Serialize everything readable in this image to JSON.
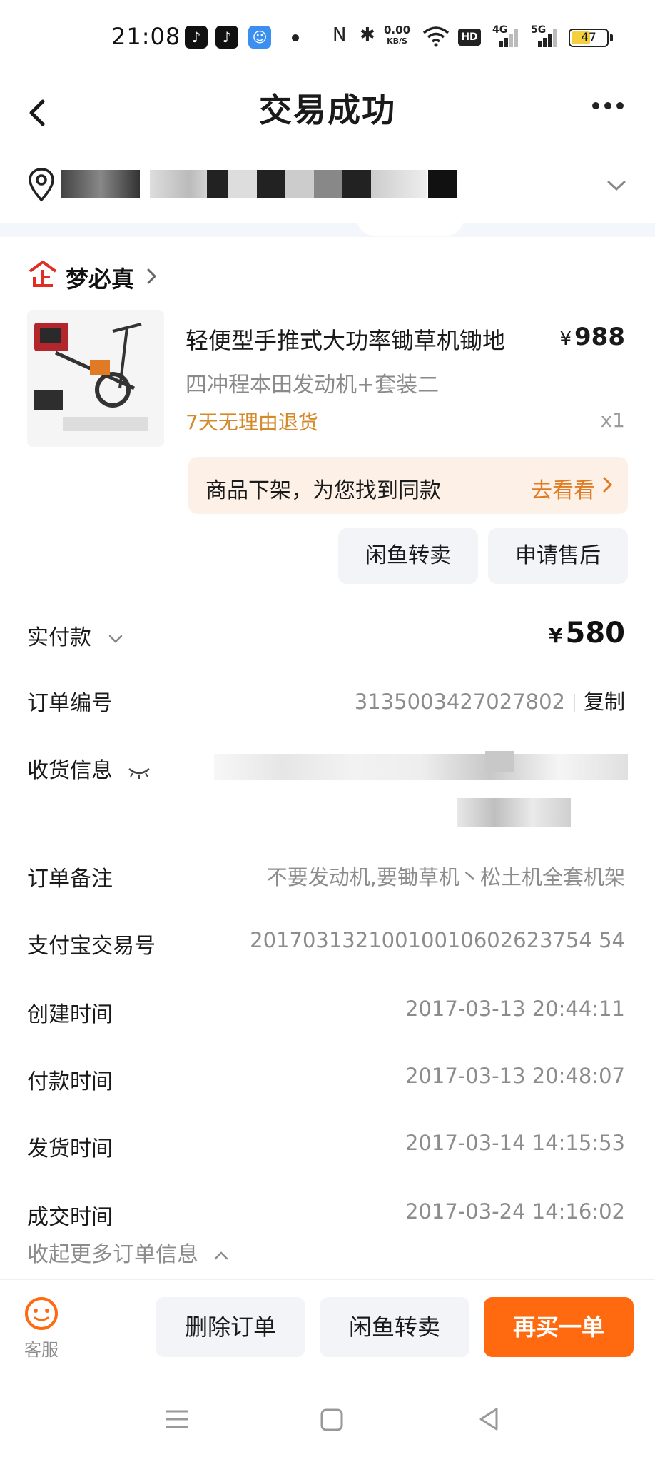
{
  "status_bar": {
    "time": "21:08",
    "net_speed_value": "0.00",
    "net_speed_unit": "KB/S",
    "hd_label": "HD",
    "net_4g": "4G",
    "net_5g": "5G",
    "battery": "47"
  },
  "nav": {
    "title": "交易成功"
  },
  "shop": {
    "badge_icon": "enterprise-badge-icon",
    "name": "梦必真"
  },
  "product": {
    "title": "轻便型手推式大功率锄草机锄地",
    "price_symbol": "¥",
    "price": "988",
    "spec": "四冲程本田发动机+套装二",
    "return_policy": "7天无理由退货",
    "quantity": "x1"
  },
  "off_shelf": {
    "text": "商品下架，为您找到同款",
    "link": "去看看"
  },
  "actions": {
    "resell": "闲鱼转卖",
    "after_sale": "申请售后"
  },
  "order": {
    "paid_label": "实付款",
    "paid_symbol": "¥",
    "paid_amount": "580",
    "number_label": "订单编号",
    "number_value": "3135003427027802",
    "copy_label": "复制",
    "shipping_label": "收货信息",
    "remark_label": "订单备注",
    "remark_value": "不要发动机,要锄草机丶松土机全套机架",
    "alipay_label": "支付宝交易号",
    "alipay_value": "20170313210010010602623754 54",
    "created_label": "创建时间",
    "created_value": "2017-03-13 20:44:11",
    "paid_time_label": "付款时间",
    "paid_time_value": "2017-03-13 20:48:07",
    "shipped_label": "发货时间",
    "shipped_value": "2017-03-14 14:15:53",
    "completed_label": "成交时间",
    "completed_value": "2017-03-24 14:16:02",
    "collapse_label": "收起更多订单信息"
  },
  "bottom_bar": {
    "service_label": "客服",
    "delete": "删除订单",
    "resell": "闲鱼转卖",
    "rebuy": "再买一单"
  },
  "colors": {
    "accent_orange": "#ff6a10",
    "return_orange": "#d4892b",
    "offshelf_bg": "#fdf1e7"
  }
}
